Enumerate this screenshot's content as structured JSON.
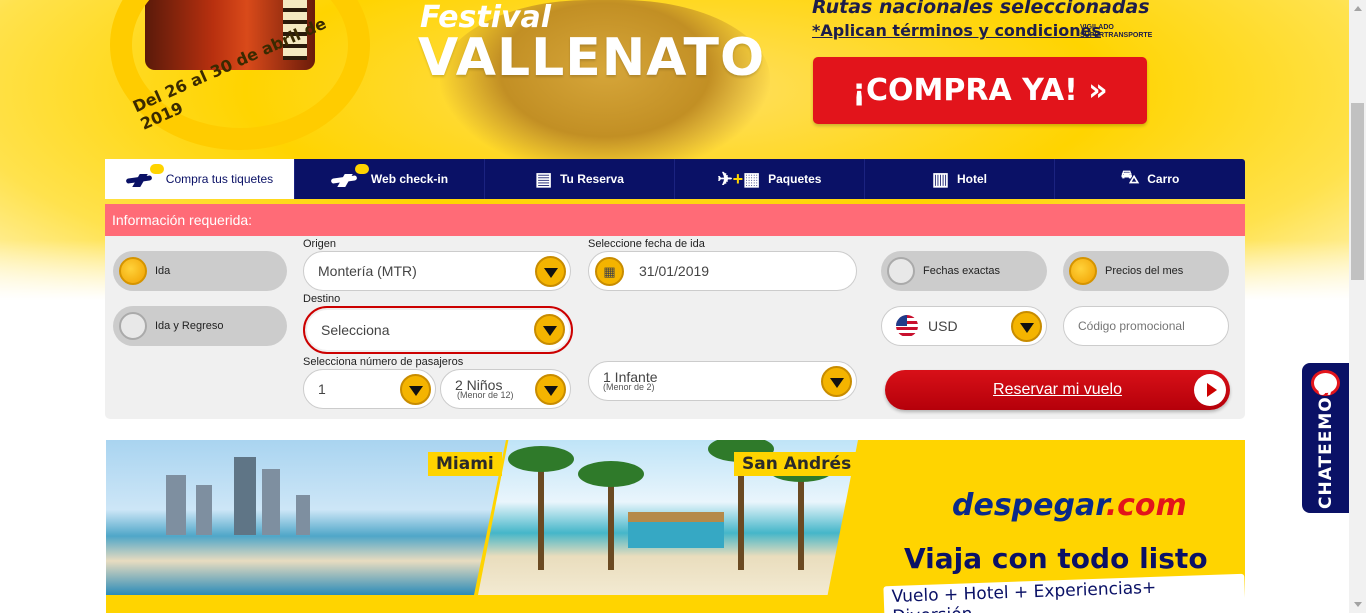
{
  "hero": {
    "date_text": "Del 26 al 30 de abril de 2019",
    "festival_small": "Festival",
    "festival_big": "VALLENATO",
    "rutas": "Rutas nacionales seleccionadas",
    "terminos": "*Aplican términos y condiciones",
    "vigilado": "VIGILADO SUPERTRANSPORTE",
    "cta_label": "¡COMPRA YA!  »",
    "accent_color": "#ffd400",
    "cta_color": "#e2141b"
  },
  "tabs": [
    {
      "label": "Compra tus tiquetes",
      "icon": "plane-icon",
      "active": true
    },
    {
      "label": "Web check-in",
      "icon": "plane-icon",
      "active": false
    },
    {
      "label": "Tu Reserva",
      "icon": "booking-icon",
      "active": false
    },
    {
      "label": "Paquetes",
      "icon": "plane-hotel-icon",
      "active": false
    },
    {
      "label": "Hotel",
      "icon": "building-icon",
      "active": false
    },
    {
      "label": "Carro",
      "icon": "car-icon",
      "active": false
    }
  ],
  "form": {
    "required_info": "Información requerida:",
    "trip_type": {
      "one_way": "Ida",
      "round_trip": "Ida y Regreso",
      "selected": "Ida"
    },
    "origin": {
      "label": "Origen",
      "value": "Montería (MTR)"
    },
    "destination": {
      "label": "Destino",
      "value": "Selecciona"
    },
    "date": {
      "label": "Seleccione fecha de ida",
      "value": "31/01/2019"
    },
    "passengers": {
      "label": "Selecciona número de pasajeros",
      "adults": "1",
      "children": "2 Niños",
      "children_sub": "(Menor de 12)",
      "infants": "1 Infante",
      "infants_sub": "(Menor de 2)"
    },
    "date_mode": {
      "exact": "Fechas exactas",
      "month": "Precios del mes",
      "selected": "Precios del mes"
    },
    "currency": "USD",
    "promo_placeholder": "Código promocional",
    "submit_label": "Reservar mi vuelo"
  },
  "promo": {
    "city_1": "Miami",
    "city_2": "San Andrés",
    "brand_a": "despegar",
    "brand_b": ".com",
    "headline": "Viaja con todo listo",
    "subline": "Vuelo + Hotel + Experiencias+ Diversión"
  },
  "chat": {
    "label": "CHATEEMOS"
  }
}
